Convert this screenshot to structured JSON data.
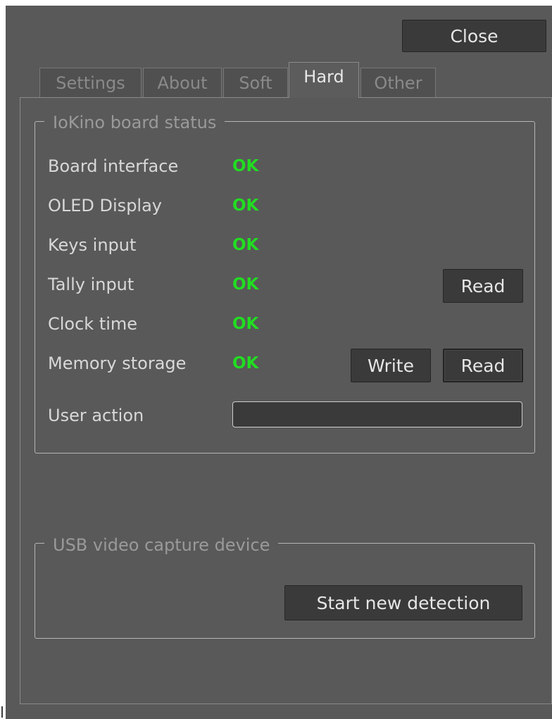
{
  "header": {
    "close_label": "Close"
  },
  "tabs": [
    {
      "label": "Settings",
      "active": false
    },
    {
      "label": "About",
      "active": false
    },
    {
      "label": "Soft",
      "active": false
    },
    {
      "label": "Hard",
      "active": true
    },
    {
      "label": "Other",
      "active": false
    }
  ],
  "board_status": {
    "title": "IoKino board status",
    "rows": [
      {
        "label": "Board interface",
        "status": "OK"
      },
      {
        "label": "OLED Display",
        "status": "OK"
      },
      {
        "label": "Keys input",
        "status": "OK"
      },
      {
        "label": "Tally input",
        "status": "OK"
      },
      {
        "label": "Clock time",
        "status": "OK"
      },
      {
        "label": "Memory storage",
        "status": "OK"
      }
    ],
    "tally_read_label": "Read",
    "memory_write_label": "Write",
    "memory_read_label": "Read",
    "user_action_label": "User action",
    "user_action_value": ""
  },
  "usb_capture": {
    "title": "USB video capture device",
    "start_detection_label": "Start new detection"
  },
  "colors": {
    "window_bg": "#595959",
    "button_bg": "#3a3a3a",
    "status_ok": "#22dd22",
    "text": "#d8d8d8",
    "muted_text": "#9a9a9a"
  }
}
